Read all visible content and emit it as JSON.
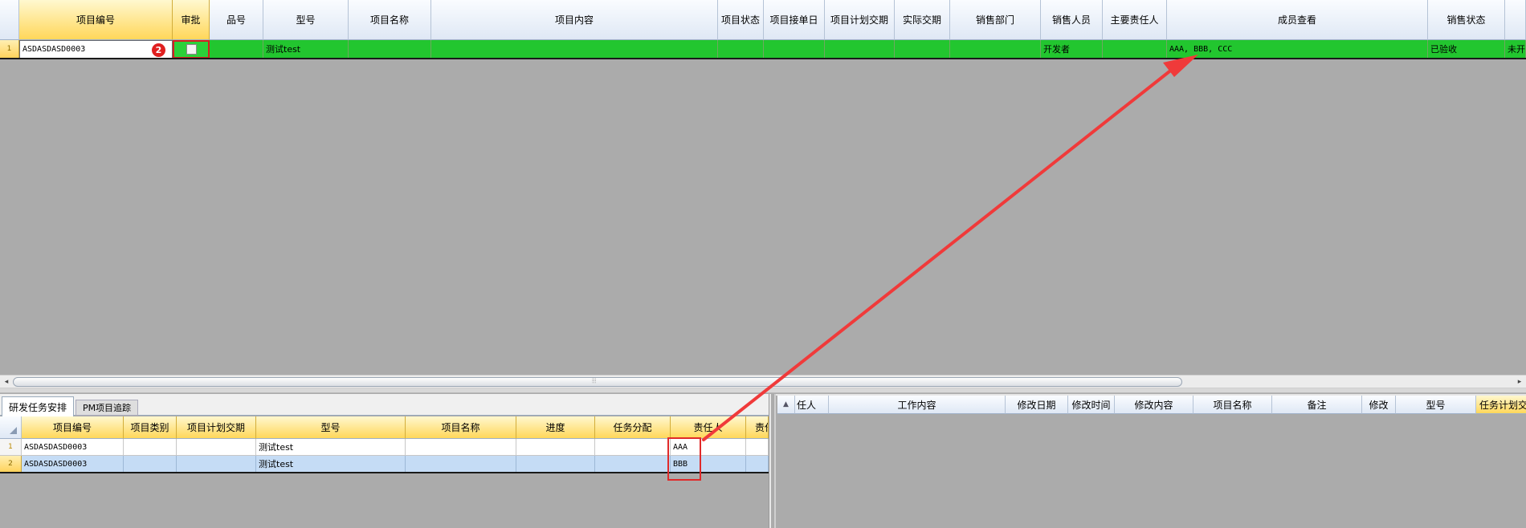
{
  "top_grid": {
    "columns": [
      "项目编号",
      "审批",
      "品号",
      "型号",
      "项目名称",
      "项目内容",
      "项目状态",
      "项目接单日",
      "项目计划交期",
      "实际交期",
      "销售部门",
      "销售人员",
      "主要责任人",
      "成员查看",
      "销售状态"
    ],
    "overflow_header": "",
    "row": {
      "index": "1",
      "project_no": "ASDASDASD0003",
      "badge": "2",
      "model": "测试test",
      "salesperson": "开发者",
      "members": "AAA, BBB, CCC",
      "sales_status": "已验收",
      "overflow_text": "未开"
    }
  },
  "scrollbar": {
    "grip": "⦙⦙⦙"
  },
  "bottom_left": {
    "tabs": [
      "研发任务安排",
      "PM项目追踪"
    ],
    "columns": [
      "项目编号",
      "项目类别",
      "项目计划交期",
      "型号",
      "项目名称",
      "进度",
      "任务分配",
      "责任人",
      "责任"
    ],
    "rows": [
      {
        "index": "1",
        "project_no": "ASDASDASD0003",
        "model": "测试test",
        "owner": "AAA"
      },
      {
        "index": "2",
        "project_no": "ASDASDASD0003",
        "model": "测试test",
        "owner": "BBB"
      }
    ]
  },
  "bottom_right": {
    "columns": [
      "任人",
      "工作内容",
      "修改日期",
      "修改时间",
      "修改内容",
      "项目名称",
      "备注",
      "修改",
      "型号",
      "任务计划交期"
    ],
    "corner_icon": "sort-icon"
  },
  "colors": {
    "row_green": "#22c62f",
    "accent_red": "#f03a3a",
    "header_yellow": "#ffd75a"
  }
}
